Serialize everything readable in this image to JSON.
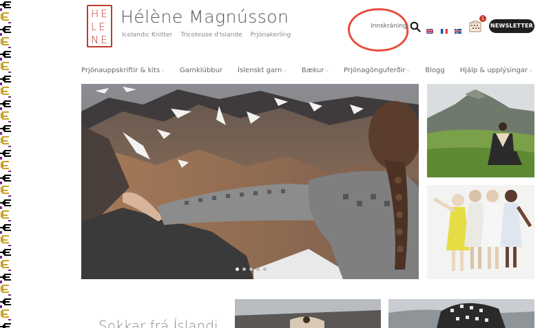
{
  "logo": {
    "letters": [
      "HE",
      "LE",
      "NE"
    ]
  },
  "brand": {
    "name": "Hélène Magnússon",
    "taglines": [
      "Icelandic Knitter",
      "Tricoteuse d'Islande",
      "Prjónakerling"
    ]
  },
  "header": {
    "login_label": "Innskráning",
    "cart_count": "1",
    "newsletter_label": "NEWSLETTER"
  },
  "nav": {
    "items": [
      {
        "label": "Prjónauppskriftir & kits",
        "has_dropdown": true
      },
      {
        "label": "Garnklúbbur",
        "has_dropdown": false
      },
      {
        "label": "Íslenskt garn",
        "has_dropdown": true
      },
      {
        "label": "Bækur",
        "has_dropdown": true
      },
      {
        "label": "Prjónagönguferðir",
        "has_dropdown": true
      },
      {
        "label": "Blogg",
        "has_dropdown": false
      },
      {
        "label": "Hjálp & upplýsingar",
        "has_dropdown": true
      }
    ]
  },
  "slider": {
    "total_slides": 5,
    "active_slide": 1
  },
  "bottom": {
    "section_title": "Sokkar frá Íslandi"
  },
  "colors": {
    "brand_red": "#c0392b",
    "annotation_red": "#e74c3c",
    "button_dark": "#1f1f1f"
  }
}
